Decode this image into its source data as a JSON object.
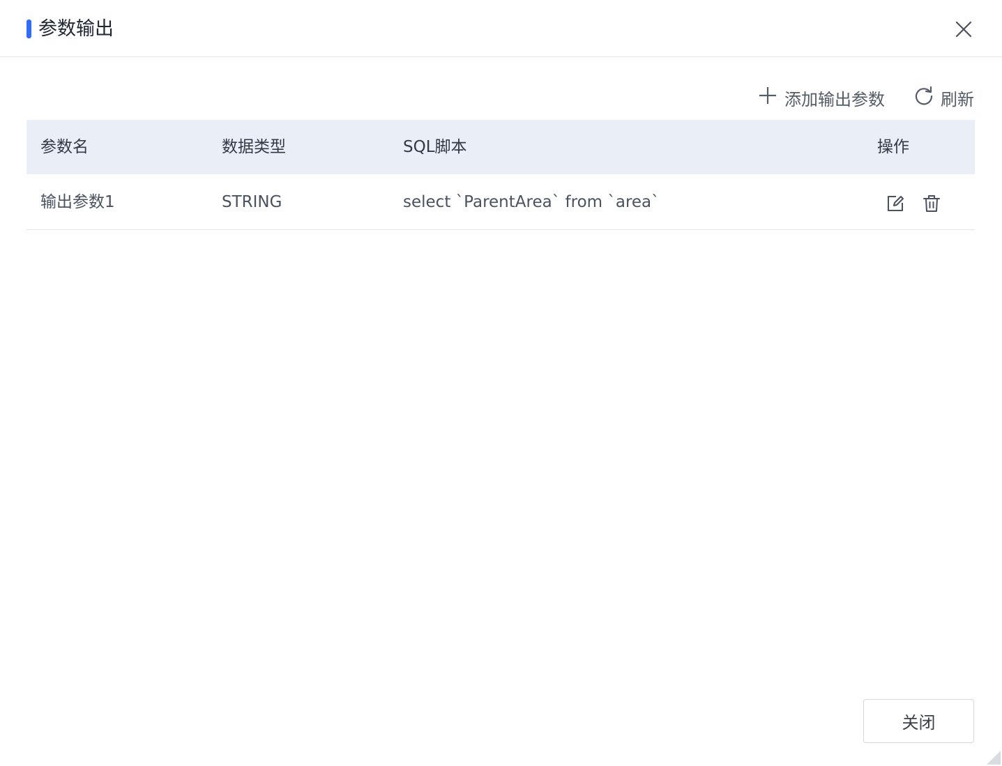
{
  "dialog": {
    "title": "参数输出",
    "close_icon": "close-icon",
    "accent_color": "#2f6bff"
  },
  "toolbar": {
    "add_label": "添加输出参数",
    "add_icon": "plus-icon",
    "refresh_label": "刷新",
    "refresh_icon": "refresh-icon"
  },
  "table": {
    "columns": [
      "参数名",
      "数据类型",
      "SQL脚本",
      "操作"
    ],
    "rows": [
      {
        "name": "输出参数1",
        "type": "STRING",
        "sql": "select `ParentArea` from `area`",
        "actions": [
          "edit-icon",
          "delete-icon"
        ]
      }
    ]
  },
  "footer": {
    "close_label": "关闭"
  }
}
